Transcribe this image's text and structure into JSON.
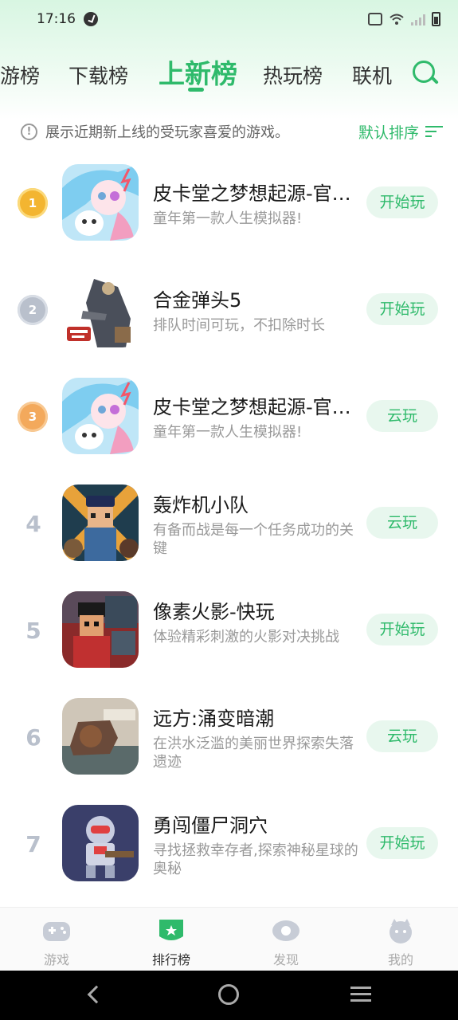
{
  "status_bar": {
    "time": "17:16"
  },
  "tabs": [
    {
      "label": "游榜",
      "active": false
    },
    {
      "label": "下载榜",
      "active": false
    },
    {
      "label": "上新榜",
      "active": true
    },
    {
      "label": "热玩榜",
      "active": false
    },
    {
      "label": "联机",
      "active": false
    }
  ],
  "info": {
    "text": "展示近期新上线的受玩家喜爱的游戏。",
    "sort_label": "默认排序"
  },
  "games": [
    {
      "rank": "1",
      "name": "皮卡堂之梦想起源-官方版",
      "desc": "童年第一款人生模拟器!",
      "action": "开始玩"
    },
    {
      "rank": "2",
      "name": "合金弹头5",
      "desc": "排队时间可玩，不扣除时长",
      "action": "开始玩"
    },
    {
      "rank": "3",
      "name": "皮卡堂之梦想起源-官方版",
      "desc": "童年第一款人生模拟器!",
      "action": "云玩"
    },
    {
      "rank": "4",
      "name": "轰炸机小队",
      "desc": "有备而战是每一个任务成功的关键",
      "action": "云玩"
    },
    {
      "rank": "5",
      "name": "像素火影-快玩",
      "desc": "体验精彩刺激的火影对决挑战",
      "action": "开始玩"
    },
    {
      "rank": "6",
      "name": "远方:涌变暗潮",
      "desc": "在洪水泛滥的美丽世界探索失落遗迹",
      "action": "云玩"
    },
    {
      "rank": "7",
      "name": "勇闯僵尸洞穴",
      "desc": "寻找拯救幸存者,探索神秘星球的奥秘",
      "action": "开始玩"
    }
  ],
  "bottom_nav": [
    {
      "label": "游戏",
      "icon": "gamepad-icon",
      "active": false
    },
    {
      "label": "排行榜",
      "icon": "ranking-badge-icon",
      "active": true
    },
    {
      "label": "发现",
      "icon": "eye-icon",
      "active": false
    },
    {
      "label": "我的",
      "icon": "profile-icon",
      "active": false
    }
  ],
  "colors": {
    "accent": "#2fba6b",
    "gold": "#f3b531",
    "silver": "#b9c0cc",
    "bronze": "#f3a95c"
  }
}
